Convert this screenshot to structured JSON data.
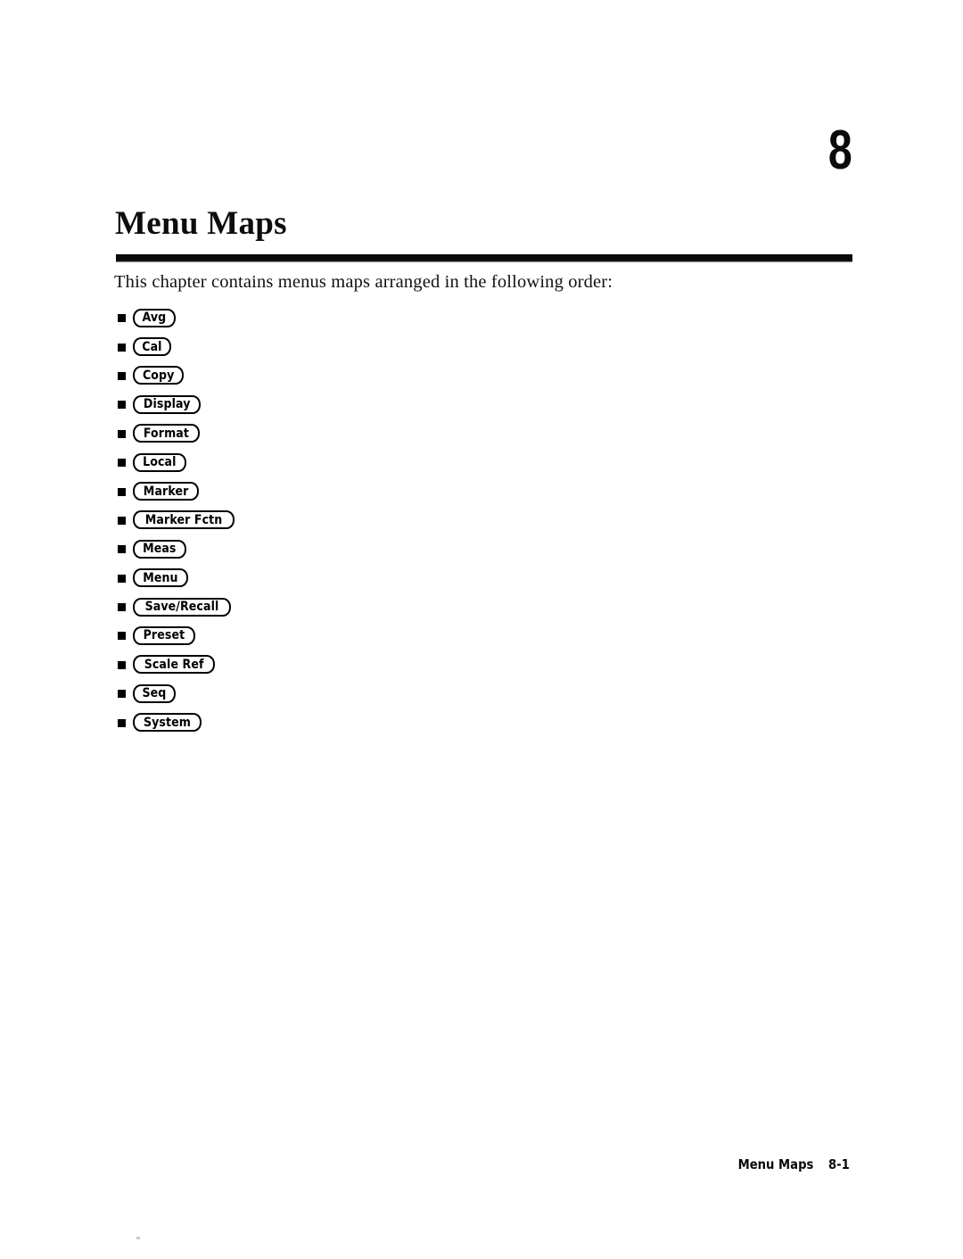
{
  "page": {
    "chapter_number": "8",
    "title": "Menu Maps",
    "intro": "This chapter contains menus maps arranged in the following order:"
  },
  "key_list": {
    "items": [
      {
        "label": "Avg"
      },
      {
        "label": "Cal"
      },
      {
        "label": "Copy"
      },
      {
        "label": "Display"
      },
      {
        "label": "Format"
      },
      {
        "label": "Local"
      },
      {
        "label": "Marker"
      },
      {
        "label": "Marker Fctn"
      },
      {
        "label": "Meas"
      },
      {
        "label": "Menu"
      },
      {
        "label": "Save/Recall"
      },
      {
        "label": "Preset"
      },
      {
        "label": "Scale Ref"
      },
      {
        "label": "Seq"
      },
      {
        "label": "System"
      }
    ]
  },
  "footer": {
    "label": "Menu Maps",
    "page_number": "8-1"
  },
  "colors": {
    "ink": "#000000",
    "paper": "#ffffff",
    "rule": "#0a0a0a"
  }
}
